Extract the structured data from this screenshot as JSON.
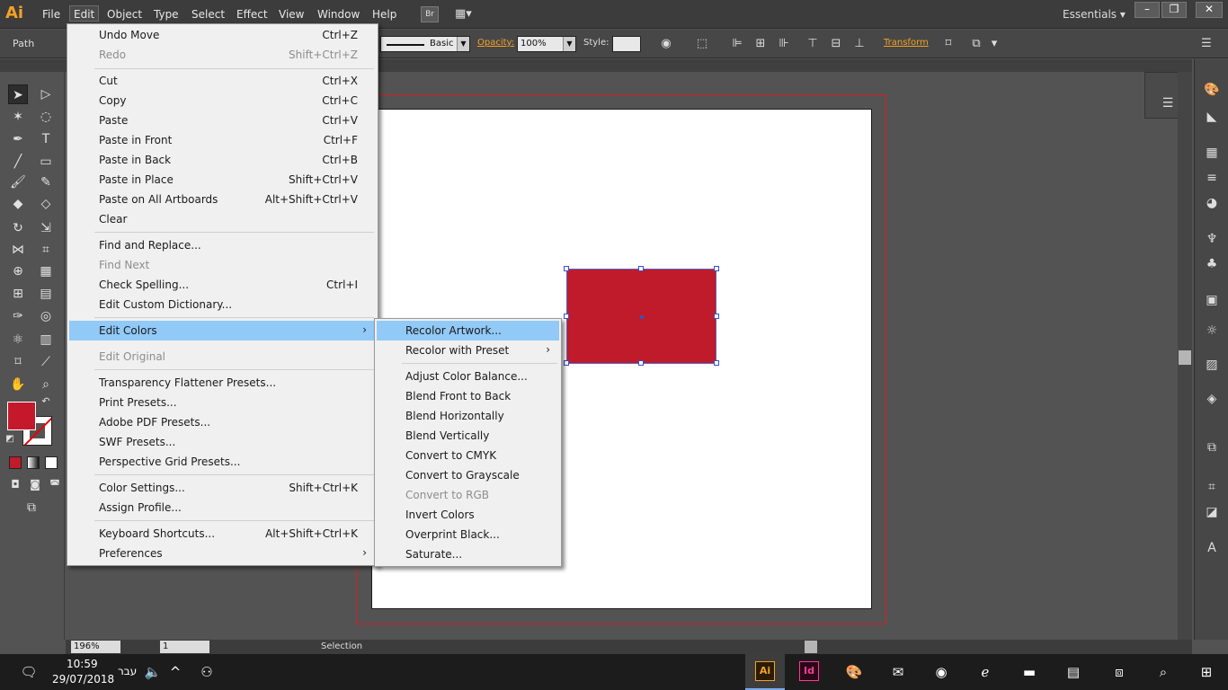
{
  "app": {
    "logo": "Ai"
  },
  "menubar": {
    "items": [
      "File",
      "Edit",
      "Object",
      "Type",
      "Select",
      "Effect",
      "View",
      "Window",
      "Help"
    ],
    "br_label": "Br",
    "workspace": "Essentials ▾",
    "win_minimize": "–",
    "win_restore": "❐",
    "win_close": "✕"
  },
  "controlbar": {
    "selection_type": "Path",
    "stroke_profile": "Basic",
    "opacity_label": "Opacity:",
    "opacity_value": "100%",
    "style_label": "Style:",
    "transform_label": "Transform"
  },
  "edit_menu": {
    "items": [
      {
        "label": "Undo Move",
        "shortcut": "Ctrl+Z"
      },
      {
        "label": "Redo",
        "shortcut": "Shift+Ctrl+Z",
        "disabled": true
      },
      {
        "label": "Cut",
        "shortcut": "Ctrl+X"
      },
      {
        "label": "Copy",
        "shortcut": "Ctrl+C"
      },
      {
        "label": "Paste",
        "shortcut": "Ctrl+V"
      },
      {
        "label": "Paste in Front",
        "shortcut": "Ctrl+F"
      },
      {
        "label": "Paste in Back",
        "shortcut": "Ctrl+B"
      },
      {
        "label": "Paste in Place",
        "shortcut": "Shift+Ctrl+V"
      },
      {
        "label": "Paste on All Artboards",
        "shortcut": "Alt+Shift+Ctrl+V"
      },
      {
        "label": "Clear",
        "shortcut": ""
      },
      {
        "label": "Find and Replace...",
        "shortcut": ""
      },
      {
        "label": "Find Next",
        "shortcut": "",
        "disabled": true
      },
      {
        "label": "Check Spelling...",
        "shortcut": "Ctrl+I"
      },
      {
        "label": "Edit Custom Dictionary...",
        "shortcut": ""
      },
      {
        "label": "Edit Colors",
        "shortcut": "",
        "submenu": true,
        "highlighted": true
      },
      {
        "label": "Edit Original",
        "shortcut": "",
        "disabled": true
      },
      {
        "label": "Transparency Flattener Presets...",
        "shortcut": ""
      },
      {
        "label": "Print Presets...",
        "shortcut": ""
      },
      {
        "label": "Adobe PDF Presets...",
        "shortcut": ""
      },
      {
        "label": "SWF Presets...",
        "shortcut": ""
      },
      {
        "label": "Perspective Grid Presets...",
        "shortcut": ""
      },
      {
        "label": "Color Settings...",
        "shortcut": "Shift+Ctrl+K"
      },
      {
        "label": "Assign Profile...",
        "shortcut": ""
      },
      {
        "label": "Keyboard Shortcuts...",
        "shortcut": "Alt+Shift+Ctrl+K"
      },
      {
        "label": "Preferences",
        "shortcut": "",
        "submenu": true
      }
    ]
  },
  "edit_colors_submenu": {
    "items": [
      {
        "label": "Recolor Artwork...",
        "highlighted": true
      },
      {
        "label": "Recolor with Preset",
        "submenu": true
      },
      {
        "label": "Adjust Color Balance..."
      },
      {
        "label": "Blend Front to Back"
      },
      {
        "label": "Blend Horizontally"
      },
      {
        "label": "Blend Vertically"
      },
      {
        "label": "Convert to CMYK"
      },
      {
        "label": "Convert to Grayscale"
      },
      {
        "label": "Convert to RGB",
        "disabled": true
      },
      {
        "label": "Invert Colors"
      },
      {
        "label": "Overprint Black..."
      },
      {
        "label": "Saturate..."
      }
    ]
  },
  "statusbar": {
    "zoom": "196%",
    "artboard_number": "1",
    "tool_status": "Selection"
  },
  "taskbar": {
    "time": "10:59",
    "date": "29/07/2018",
    "language": "עבר"
  },
  "colors": {
    "fill": "#c01b2a",
    "accent": "#f4a124",
    "menu_highlight": "#91c9f7"
  }
}
